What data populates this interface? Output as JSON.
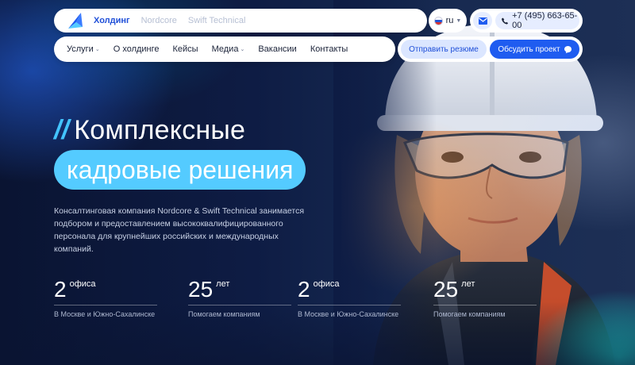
{
  "header": {
    "brand_links": [
      "Холдинг",
      "Nordcore",
      "Swift Technical"
    ],
    "lang": "ru",
    "phone": "+7 (495) 663-65-00"
  },
  "nav": {
    "items": [
      {
        "label": "Услуги",
        "dropdown": true
      },
      {
        "label": "О холдинге",
        "dropdown": false
      },
      {
        "label": "Кейсы",
        "dropdown": false
      },
      {
        "label": "Медиа",
        "dropdown": true
      },
      {
        "label": "Вакансии",
        "dropdown": false
      },
      {
        "label": "Контакты",
        "dropdown": false
      }
    ],
    "resume_label": "Отправить резюме",
    "project_label": "Обсудить проект"
  },
  "hero": {
    "slashes": "//",
    "headline_1": "Комплексные",
    "headline_2": "кадровые решения",
    "description": "Консалтинговая компания Nordcore & Swift Technical занимается подбором и предоставлением высококвалифицированного персонала для крупнейших российских и международных компаний."
  },
  "stats": [
    {
      "num": "2",
      "unit": "офиса",
      "label": "В Москве и Южно-Сахалинске"
    },
    {
      "num": "25",
      "unit": "лет",
      "label": "Помогаем компаниям"
    },
    {
      "num": "2",
      "unit": "офиса",
      "label": "В Москве и Южно-Сахалинске"
    },
    {
      "num": "25",
      "unit": "лет",
      "label": "Помогаем компаниям"
    }
  ],
  "colors": {
    "accent_blue": "#1f5cf0",
    "hero_cyan": "#54cbff",
    "background": "#0b1533"
  }
}
